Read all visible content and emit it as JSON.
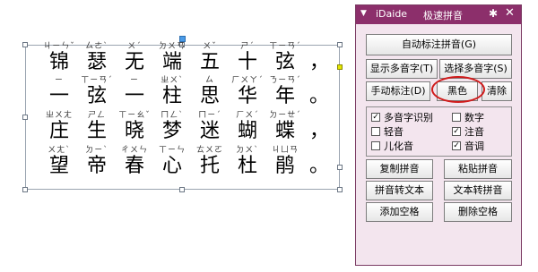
{
  "panel": {
    "logo": "iDaide",
    "title": "极速拼音",
    "buttons": {
      "auto_annotate": "自动标注拼音(G)",
      "show_polyphones": "显示多音字(T)",
      "select_polyphones": "选择多音字(S)",
      "manual_annotate": "手动标注(D)",
      "black": "黑色",
      "clear": "清除",
      "copy_pinyin": "复制拼音",
      "paste_pinyin": "粘贴拼音",
      "pinyin_to_text": "拼音转文本",
      "text_to_pinyin": "文本转拼音",
      "add_space": "添加空格",
      "delete_space": "删除空格"
    },
    "options": [
      {
        "label": "多音字识别",
        "checked": true
      },
      {
        "label": "数字",
        "checked": false
      },
      {
        "label": "轻音",
        "checked": false
      },
      {
        "label": "注音",
        "checked": true
      },
      {
        "label": "儿化音",
        "checked": false
      },
      {
        "label": "音调",
        "checked": true
      }
    ]
  },
  "text": {
    "rows": [
      {
        "chars": [
          "锦",
          "瑟",
          "无",
          "端",
          "五",
          "十",
          "弦",
          "，"
        ],
        "zhuyin": [
          "ㄐㄧㄣˇ",
          "ㄙㄜˋ",
          "ㄨˊ",
          "ㄉㄨㄢ",
          "ㄨˇ",
          "ㄕˊ",
          "ㄒㄧㄢˊ",
          ""
        ]
      },
      {
        "chars": [
          "一",
          "弦",
          "一",
          "柱",
          "思",
          "华",
          "年",
          "。"
        ],
        "zhuyin": [
          "ㄧ",
          "ㄒㄧㄢˊ",
          "ㄧ",
          "ㄓㄨˋ",
          "ㄙ",
          "ㄏㄨㄚˊ",
          "ㄋㄧㄢˊ",
          ""
        ]
      },
      {
        "chars": [
          "庄",
          "生",
          "晓",
          "梦",
          "迷",
          "蝴",
          "蝶",
          "，"
        ],
        "zhuyin": [
          "ㄓㄨㄤ",
          "ㄕㄥ",
          "ㄒㄧㄠˇ",
          "ㄇㄥˋ",
          "ㄇㄧˊ",
          "ㄏㄨˊ",
          "ㄉㄧㄝˊ",
          ""
        ]
      },
      {
        "chars": [
          "望",
          "帝",
          "春",
          "心",
          "托",
          "杜",
          "鹃",
          "。"
        ],
        "zhuyin": [
          "ㄨㄤˋ",
          "ㄉㄧˋ",
          "ㄔㄨㄣ",
          "ㄒㄧㄣ",
          "ㄊㄨㄛ",
          "ㄉㄨˋ",
          "ㄐㄩㄢ",
          ""
        ]
      }
    ]
  }
}
